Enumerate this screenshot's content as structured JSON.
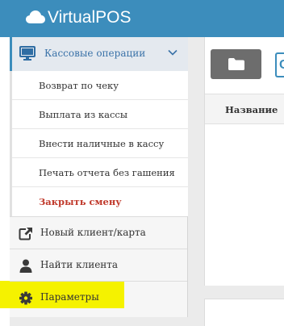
{
  "app": {
    "title": "VirtualPOS",
    "brand_color": "#3c8dbc"
  },
  "sidebar": {
    "menu_head": {
      "label": "Кассовые операции",
      "icon": "monitor-icon",
      "expanded": true
    },
    "submenu": [
      {
        "label": "Возврат по чеку"
      },
      {
        "label": "Выплата из кассы"
      },
      {
        "label": "Внести наличные в кассу"
      },
      {
        "label": "Печать отчета без гашения"
      },
      {
        "label": "Закрыть смену",
        "color": "#c0392b"
      }
    ],
    "items": [
      {
        "label": "Новый клиент/карта",
        "icon": "external-link-icon"
      },
      {
        "label": "Найти клиента",
        "icon": "user-icon"
      },
      {
        "label": "Параметры",
        "icon": "gear-icon",
        "highlight": "#f5f200"
      }
    ]
  },
  "content": {
    "toolbar": {
      "folder_button_icon": "folder-icon",
      "second_button_glyph": "C"
    },
    "table": {
      "columns": [
        "Название"
      ]
    }
  }
}
